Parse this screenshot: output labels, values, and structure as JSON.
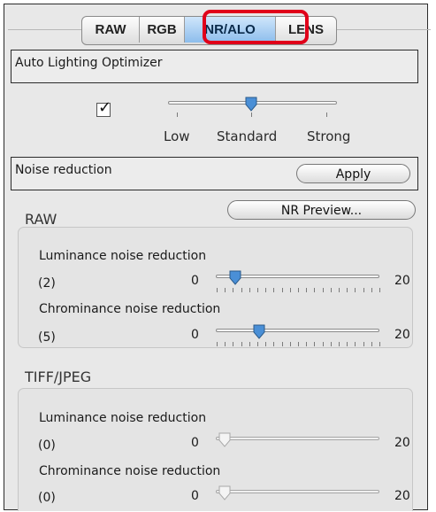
{
  "tabs": [
    "RAW",
    "RGB",
    "NR/ALO",
    "LENS"
  ],
  "alo": {
    "title": "Auto Lighting Optimizer",
    "checked": true,
    "levels": [
      "Low",
      "Standard",
      "Strong"
    ],
    "selected": "Standard"
  },
  "nr": {
    "title": "Noise reduction",
    "apply_label": "Apply",
    "preview_label": "NR Preview..."
  },
  "raw": {
    "heading": "RAW",
    "luminance": {
      "label": "Luminance noise reduction",
      "value": "(2)",
      "min": "0",
      "max": "20",
      "level": 2
    },
    "chrominance": {
      "label": "Chrominance noise reduction",
      "value": "(5)",
      "min": "0",
      "max": "20",
      "level": 5
    }
  },
  "tiff": {
    "heading": "TIFF/JPEG",
    "luminance": {
      "label": "Luminance noise reduction",
      "value": "(0)",
      "min": "0",
      "max": "20",
      "level": 0
    },
    "chrominance": {
      "label": "Chrominance noise reduction",
      "value": "(0)",
      "min": "0",
      "max": "20",
      "level": 0
    }
  },
  "colors": {
    "highlight": "#e0001a",
    "thumb_active": "#4a8fd6",
    "tab_active": "#8dbdec"
  }
}
